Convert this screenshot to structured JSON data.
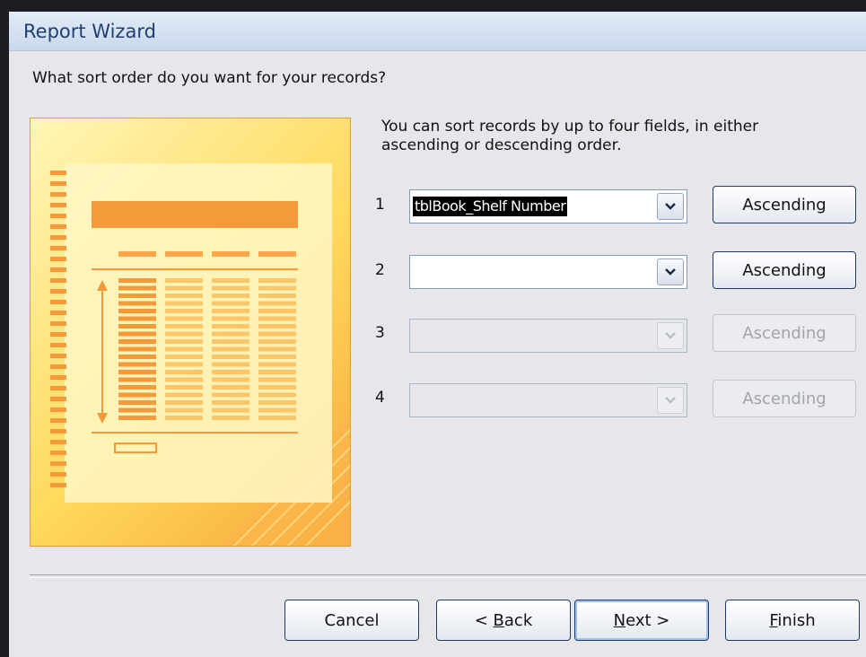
{
  "window": {
    "title": "Report Wizard"
  },
  "prompt": {
    "question": "What sort order do you want for your records?",
    "description": "You can sort records by up to four fields, in either ascending or descending order."
  },
  "sort_rows": [
    {
      "number": "1",
      "field": "tblBook_Shelf Number",
      "order": "Ascending",
      "enabled": true
    },
    {
      "number": "2",
      "field": "",
      "order": "Ascending",
      "enabled": true
    },
    {
      "number": "3",
      "field": "",
      "order": "Ascending",
      "enabled": false
    },
    {
      "number": "4",
      "field": "",
      "order": "Ascending",
      "enabled": false
    }
  ],
  "buttons": {
    "cancel": "Cancel",
    "back_prefix": "< ",
    "back_mnemonic": "B",
    "back_rest": "ack",
    "next_mnemonic": "N",
    "next_rest": "ext >",
    "finish_mnemonic": "F",
    "finish_rest": "inish"
  },
  "colors": {
    "accent": "#f59a3b",
    "title_text": "#1f3f70"
  }
}
